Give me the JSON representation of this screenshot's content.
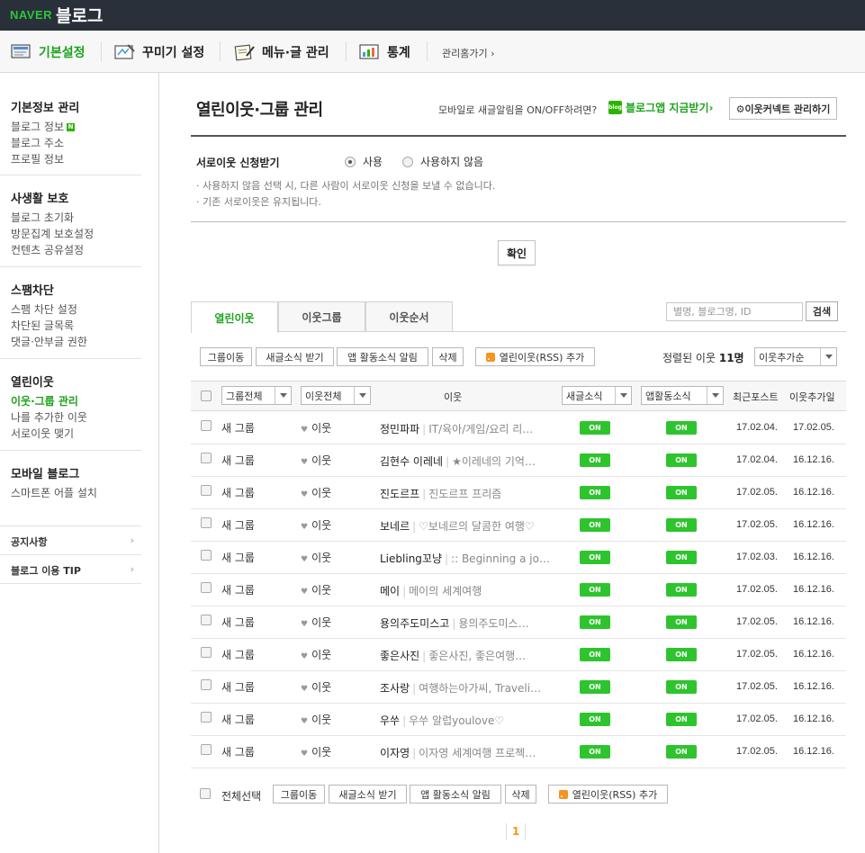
{
  "topbar": {
    "naver": "NAVER",
    "blog": "블로그"
  },
  "menu": {
    "items": [
      {
        "label": "기본설정",
        "icon": "settings-monitor-icon"
      },
      {
        "label": "꾸미기 설정",
        "icon": "palette-icon"
      },
      {
        "label": "메뉴·글 관리",
        "icon": "edit-note-icon"
      },
      {
        "label": "통계",
        "icon": "stats-chart-icon"
      }
    ],
    "home": "관리홈가기 ›"
  },
  "sidebar": {
    "groups": [
      {
        "title": "기본정보 관리",
        "links": [
          "블로그 정보",
          "블로그 주소",
          "프로필 정보"
        ],
        "new_badge": "N"
      },
      {
        "title": "사생활 보호",
        "links": [
          "블로그 초기화",
          "방문집계 보호설정",
          "컨텐츠 공유설정"
        ]
      },
      {
        "title": "스팸차단",
        "links": [
          "스팸 차단 설정",
          "차단된 글목록",
          "댓글·안부글 권한"
        ]
      },
      {
        "title": "열린이웃",
        "links": [
          "이웃·그룹 관리",
          "나를 추가한 이웃",
          "서로이웃 맺기"
        ]
      },
      {
        "title": "모바일 블로그",
        "links": [
          "스마트폰 어플 설치"
        ]
      }
    ],
    "notice": "공지사항",
    "tip": "블로그 이용 TIP",
    "arrow": "›"
  },
  "header": {
    "title": "열린이웃·그룹 관리",
    "mobile_text": "모바일로 새글알림을 ON/OFF하려면?",
    "app_icon": "blog",
    "app_link": "블로그앱 지금받기›",
    "commerce_btn": "⚙이웃커넥트 관리하기"
  },
  "setting": {
    "label": "서로이웃 신청받기",
    "options": [
      "사용",
      "사용하지 않음"
    ],
    "selected": "사용",
    "notes": [
      "· 사용하지 않음 선택 시, 다른 사람이 서로이웃 신청을 보낼 수 없습니다.",
      "· 기존 서로이웃은 유지됩니다."
    ],
    "confirm": "확인"
  },
  "tabs": [
    "열린이웃",
    "이웃그룹",
    "이웃순서"
  ],
  "search": {
    "placeholder": "별명, 블로그명, ID",
    "button": "검색"
  },
  "actions": {
    "move": "그룹이동",
    "receive": "새글소식 받기",
    "app_alert": "앱 활동소식 알림",
    "delete": "삭제",
    "rss": "열린이웃(RSS) 추가",
    "sorted_prefix": "정렬된 이웃",
    "sorted_count": "11명",
    "sort_select": "이웃추가순"
  },
  "table": {
    "headers": {
      "group_select": "그룹전체",
      "neighbor_select": "이웃전체",
      "neighbor": "이웃",
      "news": "새글소식",
      "app": "앱활동소식",
      "recent": "최근포스트",
      "added": "이웃추가일"
    },
    "rows": [
      {
        "group": "새 그룹",
        "type": "이웃",
        "nick": "정민파파",
        "blog": "IT/육아/게임/요리 리…",
        "news": "ON",
        "app": "ON",
        "recent": "17.02.04.",
        "added": "17.02.05."
      },
      {
        "group": "새 그룹",
        "type": "이웃",
        "nick": "김현수 이레네",
        "blog": "★이레네의 기억…",
        "news": "ON",
        "app": "ON",
        "recent": "17.02.04.",
        "added": "16.12.16."
      },
      {
        "group": "새 그룹",
        "type": "이웃",
        "nick": "진도르프",
        "blog": "진도르프 프리즘",
        "news": "ON",
        "app": "ON",
        "recent": "17.02.05.",
        "added": "16.12.16."
      },
      {
        "group": "새 그룹",
        "type": "이웃",
        "nick": "보네르",
        "blog": "♡보네르의 달콤한 여행♡",
        "news": "ON",
        "app": "ON",
        "recent": "17.02.05.",
        "added": "16.12.16."
      },
      {
        "group": "새 그룹",
        "type": "이웃",
        "nick": "Liebling꼬냥",
        "blog": ":: Beginning a jo…",
        "news": "ON",
        "app": "ON",
        "recent": "17.02.03.",
        "added": "16.12.16."
      },
      {
        "group": "새 그룹",
        "type": "이웃",
        "nick": "메이",
        "blog": "메이의 세계여행",
        "news": "ON",
        "app": "ON",
        "recent": "17.02.05.",
        "added": "16.12.16."
      },
      {
        "group": "새 그룹",
        "type": "이웃",
        "nick": "용의주도미스고",
        "blog": "용의주도미스…",
        "news": "ON",
        "app": "ON",
        "recent": "17.02.05.",
        "added": "16.12.16."
      },
      {
        "group": "새 그룹",
        "type": "이웃",
        "nick": "좋은사진",
        "blog": "좋은사진, 좋은여행…",
        "news": "ON",
        "app": "ON",
        "recent": "17.02.05.",
        "added": "16.12.16."
      },
      {
        "group": "새 그룹",
        "type": "이웃",
        "nick": "조사랑",
        "blog": "여행하는아가씨, Traveli…",
        "news": "ON",
        "app": "ON",
        "recent": "17.02.05.",
        "added": "16.12.16."
      },
      {
        "group": "새 그룹",
        "type": "이웃",
        "nick": "우쑤",
        "blog": "우쑤 알럽youlove♡",
        "news": "ON",
        "app": "ON",
        "recent": "17.02.05.",
        "added": "16.12.16."
      },
      {
        "group": "새 그룹",
        "type": "이웃",
        "nick": "이자영",
        "blog": "이자영 세계여행 프로젝…",
        "news": "ON",
        "app": "ON",
        "recent": "17.02.05.",
        "added": "16.12.16."
      }
    ]
  },
  "bottom": {
    "select_all": "전체선택"
  },
  "pagination": {
    "current": "1"
  },
  "colors": {
    "accent": "#1da31d",
    "on_button": "#2ec42e",
    "rss": "#f7931e",
    "topbar": "#293039"
  }
}
